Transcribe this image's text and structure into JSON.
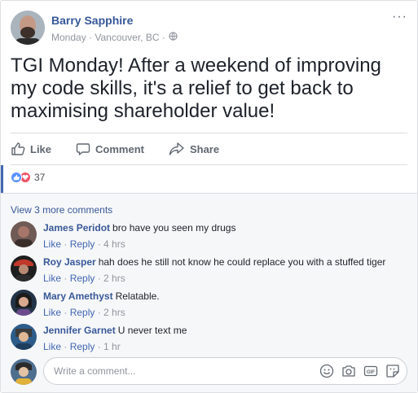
{
  "post": {
    "author": "Barry Sapphire",
    "meta": "Monday · Vancouver, BC ·",
    "text": "TGI Monday! After a weekend of improving my code skills, it's a relief to get back to maximising shareholder value!"
  },
  "actions": {
    "like": "Like",
    "comment": "Comment",
    "share": "Share"
  },
  "reactions": {
    "count": "37"
  },
  "comments": {
    "view_more": "View 3 more comments",
    "items": [
      {
        "name": "James Peridot",
        "text": "bro have you seen my drugs",
        "like": "Like",
        "reply": "Reply",
        "time": "4 hrs"
      },
      {
        "name": "Roy Jasper",
        "text": "hah does he still not know he could replace you with a stuffed tiger",
        "like": "Like",
        "reply": "Reply",
        "time": "2 hrs"
      },
      {
        "name": "Mary Amethyst",
        "text": "Relatable.",
        "like": "Like",
        "reply": "Reply",
        "time": "2 hrs"
      },
      {
        "name": "Jennifer Garnet",
        "text": "U never text me",
        "like": "Like",
        "reply": "Reply",
        "time": "1 hr"
      }
    ],
    "composer_placeholder": "Write a comment..."
  },
  "icons": {
    "more": "more-icon",
    "globe": "globe-icon",
    "like": "thumbs-up-icon",
    "comment": "comment-bubble-icon",
    "share": "share-arrow-icon",
    "emoji": "emoji-icon",
    "camera": "camera-icon",
    "gif": "gif-icon",
    "sticker": "sticker-icon"
  },
  "colors": {
    "link": "#365899",
    "like_reaction": "#5890ff",
    "love_reaction": "#f25268",
    "muted": "#90949c"
  }
}
